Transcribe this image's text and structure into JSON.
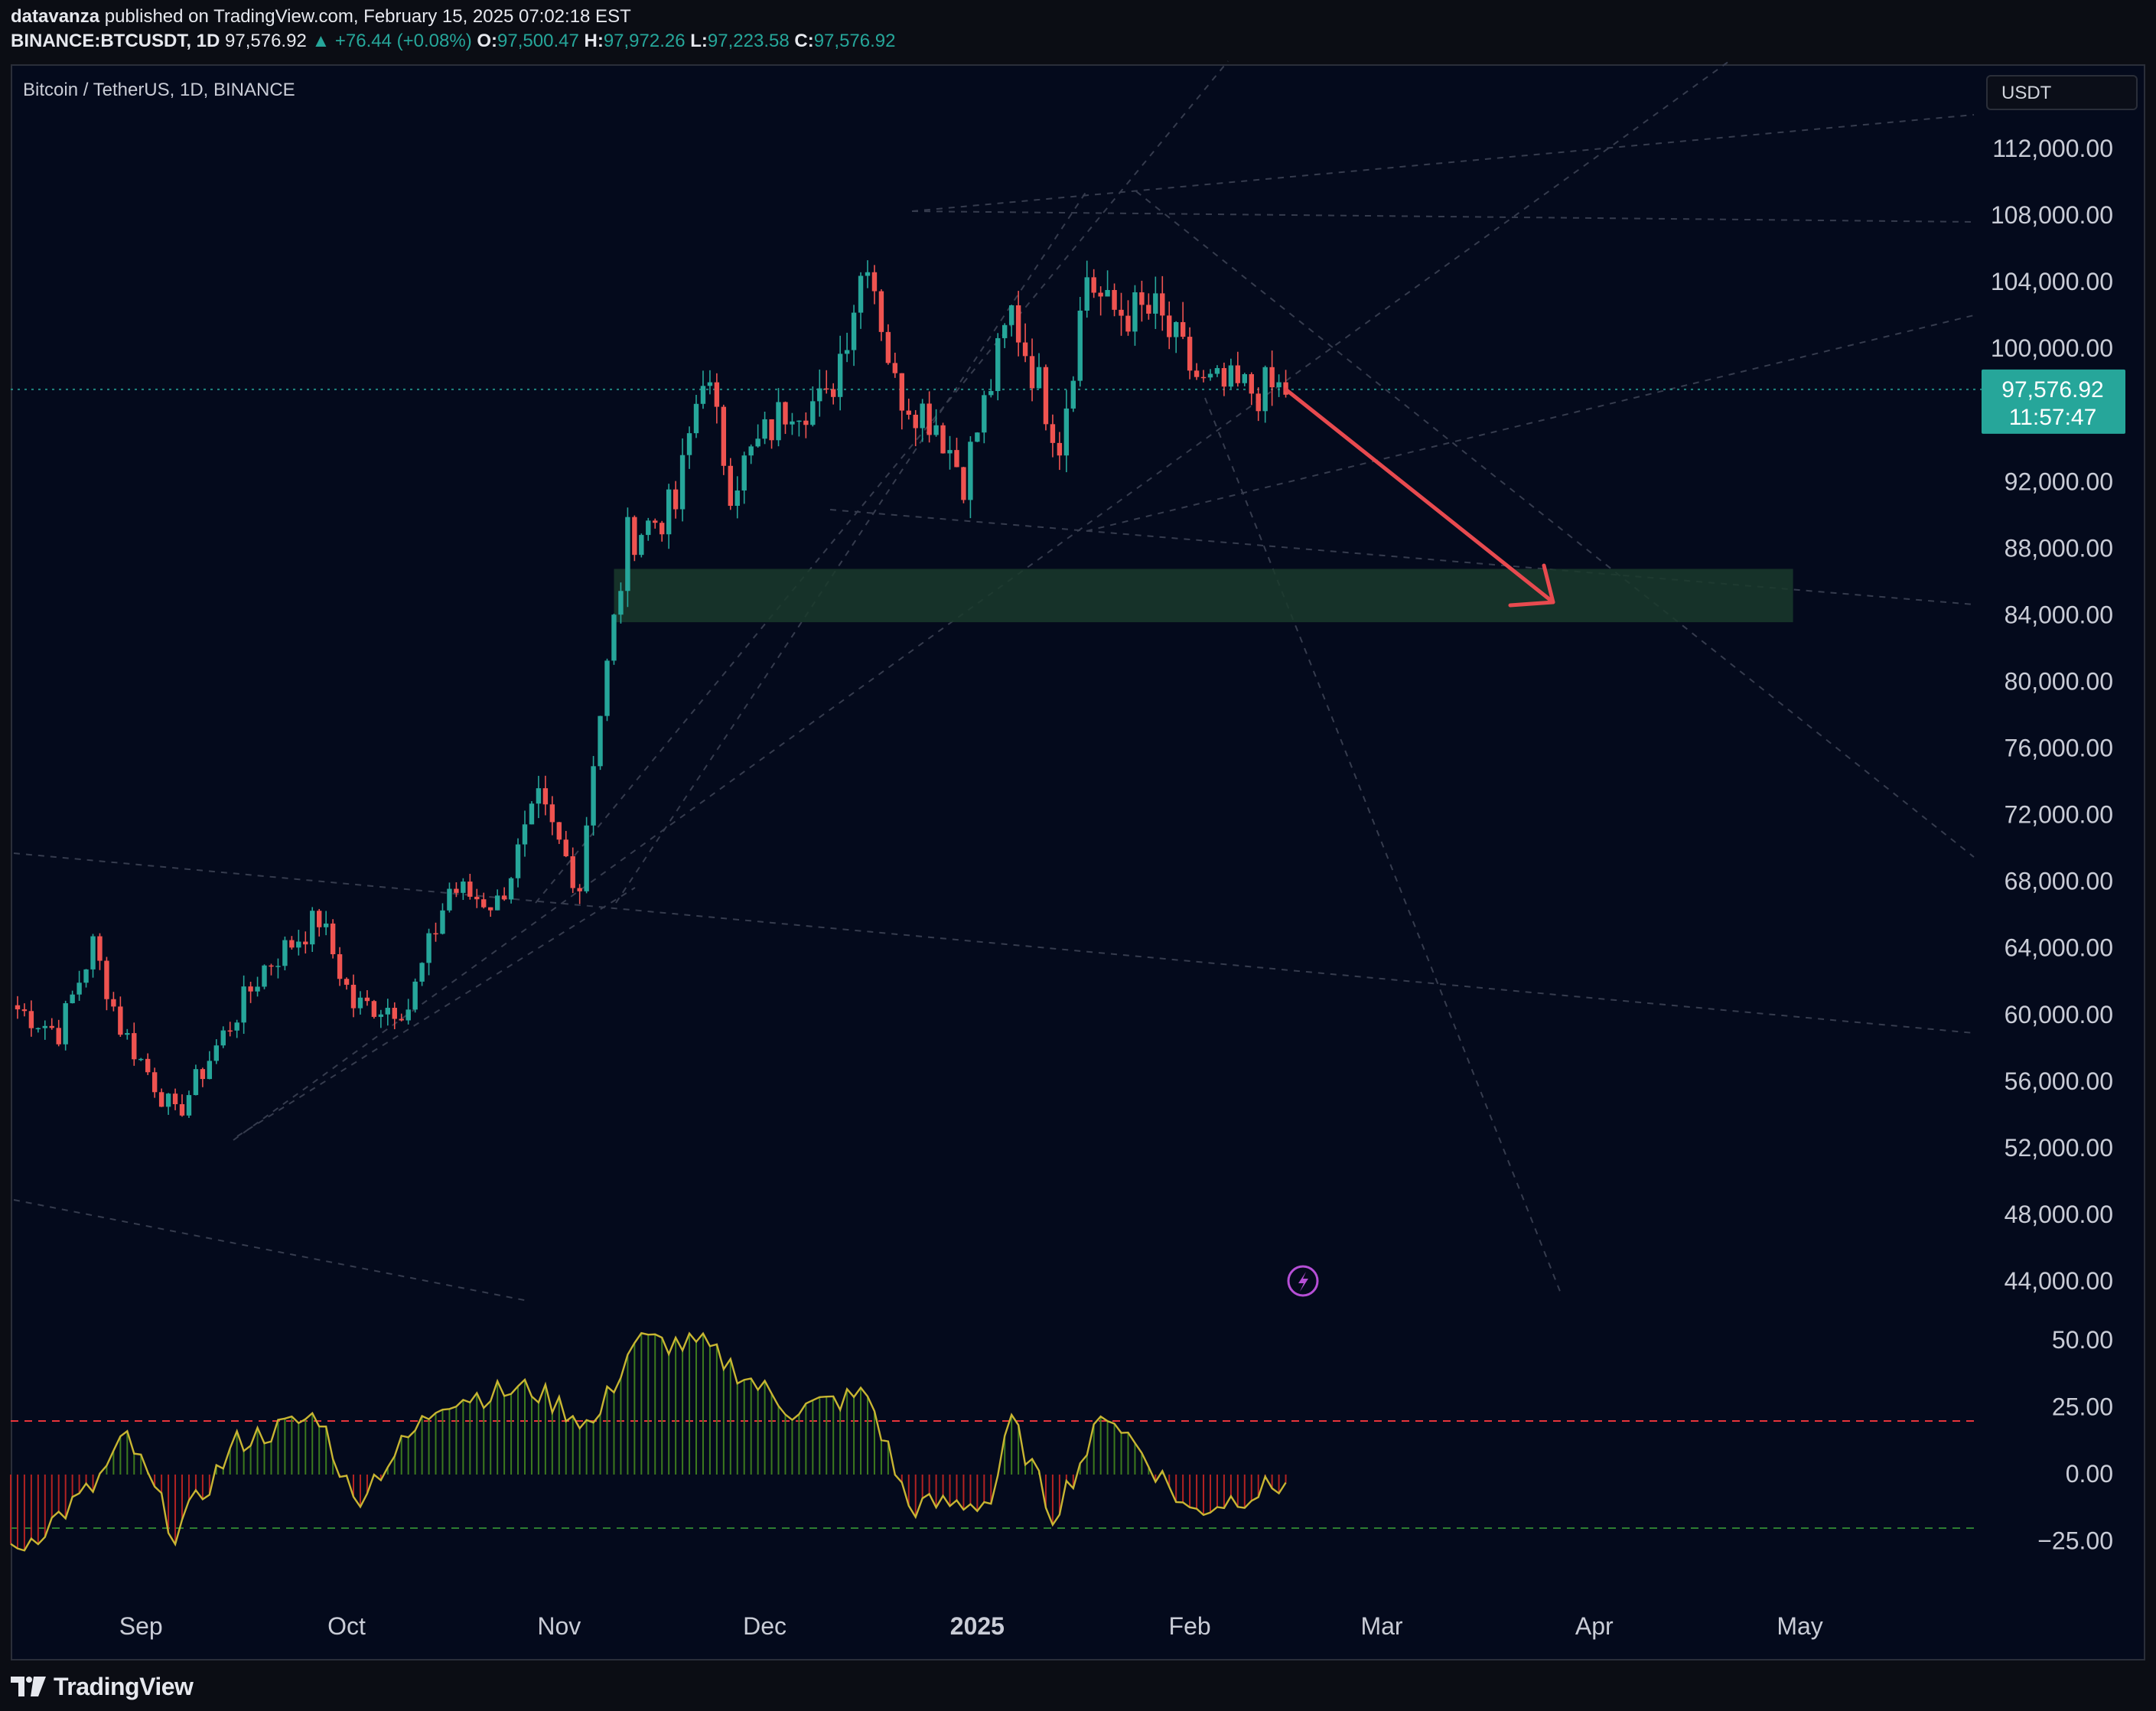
{
  "header": {
    "author": "datavanza",
    "published_text": "published on TradingView.com, February 15, 2025 07:02:18 EST",
    "symbol": "BINANCE:BTCUSDT, 1D",
    "last": "97,576.92",
    "change": "▲ +76.44 (+0.08%)",
    "o_label": "O:",
    "o_value": "97,500.47",
    "h_label": "H:",
    "h_value": "97,972.26",
    "l_label": "L:",
    "l_value": "97,223.58",
    "c_label": "C:",
    "c_value": "97,576.92"
  },
  "chart_title": "Bitcoin / TetherUS, 1D, BINANCE",
  "currency": "USDT",
  "price_badge": {
    "price": "97,576.92",
    "countdown": "11:57:47",
    "color": "#26a69a"
  },
  "footer": {
    "brand": "TradingView"
  },
  "colors": {
    "up": "#26a69a",
    "down": "#ef5350",
    "zone": "#1a3a2c",
    "arrow": "#e84a4f",
    "osc_up": "#3c7a1e",
    "osc_down": "#b22222",
    "line_red": "#e8343a",
    "line_green": "#2e7d32"
  },
  "chart_data": [
    {
      "type": "candlestick",
      "title": "Bitcoin / TetherUS, 1D, BINANCE",
      "y_axis_ticks": [
        "112,000.00",
        "108,000.00",
        "104,000.00",
        "100,000.00",
        "92,000.00",
        "88,000.00",
        "84,000.00",
        "80,000.00",
        "76,000.00",
        "72,000.00",
        "68,000.00",
        "64,000.00",
        "60,000.00",
        "56,000.00",
        "52,000.00",
        "48,000.00",
        "44,000.00"
      ],
      "ylim": [
        40000,
        114000
      ],
      "x_axis_ticks": [
        "Sep",
        "Oct",
        "Nov",
        "Dec",
        "2025",
        "Feb",
        "Mar",
        "Apr",
        "May"
      ],
      "current_price": 97576.92,
      "close_series": [
        {
          "date": "2024-08-13",
          "close": 60600
        },
        {
          "date": "2024-08-20",
          "close": 59000
        },
        {
          "date": "2024-08-25",
          "close": 64200
        },
        {
          "date": "2024-08-29",
          "close": 59300
        },
        {
          "date": "2024-09-06",
          "close": 53900
        },
        {
          "date": "2024-09-12",
          "close": 58100
        },
        {
          "date": "2024-09-19",
          "close": 62900
        },
        {
          "date": "2024-09-27",
          "close": 65800
        },
        {
          "date": "2024-10-02",
          "close": 60600
        },
        {
          "date": "2024-10-10",
          "close": 60500
        },
        {
          "date": "2024-10-16",
          "close": 67600
        },
        {
          "date": "2024-10-23",
          "close": 66700
        },
        {
          "date": "2024-10-29",
          "close": 72700
        },
        {
          "date": "2024-11-04",
          "close": 67800
        },
        {
          "date": "2024-11-06",
          "close": 75600
        },
        {
          "date": "2024-11-11",
          "close": 88700
        },
        {
          "date": "2024-11-18",
          "close": 90500
        },
        {
          "date": "2024-11-22",
          "close": 98900
        },
        {
          "date": "2024-11-26",
          "close": 91900
        },
        {
          "date": "2024-12-05",
          "close": 97000
        },
        {
          "date": "2024-12-10",
          "close": 96600
        },
        {
          "date": "2024-12-16",
          "close": 106000
        },
        {
          "date": "2024-12-20",
          "close": 97700
        },
        {
          "date": "2024-12-26",
          "close": 95700
        },
        {
          "date": "2024-12-30",
          "close": 92300
        },
        {
          "date": "2025-01-06",
          "close": 102200
        },
        {
          "date": "2025-01-13",
          "close": 94500
        },
        {
          "date": "2025-01-17",
          "close": 104500
        },
        {
          "date": "2025-01-20",
          "close": 102300
        },
        {
          "date": "2025-01-27",
          "close": 102100
        },
        {
          "date": "2025-02-03",
          "close": 97700
        },
        {
          "date": "2025-02-10",
          "close": 97500
        },
        {
          "date": "2025-02-15",
          "close": 97577
        }
      ],
      "zone": {
        "low": 83600,
        "high": 86800,
        "from": "2024-11-09",
        "to": "2025-04-30"
      },
      "projection": {
        "from": {
          "date": "2025-02-15",
          "price": 97577
        },
        "to": {
          "date": "2025-03-26",
          "price": 84800
        }
      }
    },
    {
      "type": "area",
      "title": "",
      "y_axis_ticks": [
        "50.00",
        "25.00",
        "0.00",
        "−25.00"
      ],
      "ylim": [
        -40,
        55
      ],
      "levels": [
        20,
        -20
      ],
      "values_sample": [
        {
          "date": "2024-08-13",
          "v": -30
        },
        {
          "date": "2024-08-25",
          "v": -5
        },
        {
          "date": "2024-08-30",
          "v": 14
        },
        {
          "date": "2024-09-06",
          "v": -22
        },
        {
          "date": "2024-09-15",
          "v": 12
        },
        {
          "date": "2024-09-27",
          "v": 22
        },
        {
          "date": "2024-10-02",
          "v": -10
        },
        {
          "date": "2024-10-15",
          "v": 28
        },
        {
          "date": "2024-10-28",
          "v": 32
        },
        {
          "date": "2024-11-06",
          "v": 18
        },
        {
          "date": "2024-11-12",
          "v": 50
        },
        {
          "date": "2024-11-22",
          "v": 48
        },
        {
          "date": "2024-12-05",
          "v": 24
        },
        {
          "date": "2024-12-16",
          "v": 30
        },
        {
          "date": "2024-12-22",
          "v": -12
        },
        {
          "date": "2025-01-03",
          "v": -10
        },
        {
          "date": "2025-01-06",
          "v": 20
        },
        {
          "date": "2025-01-12",
          "v": -15
        },
        {
          "date": "2025-01-20",
          "v": 24
        },
        {
          "date": "2025-02-01",
          "v": -14
        },
        {
          "date": "2025-02-15",
          "v": -3
        }
      ]
    }
  ]
}
